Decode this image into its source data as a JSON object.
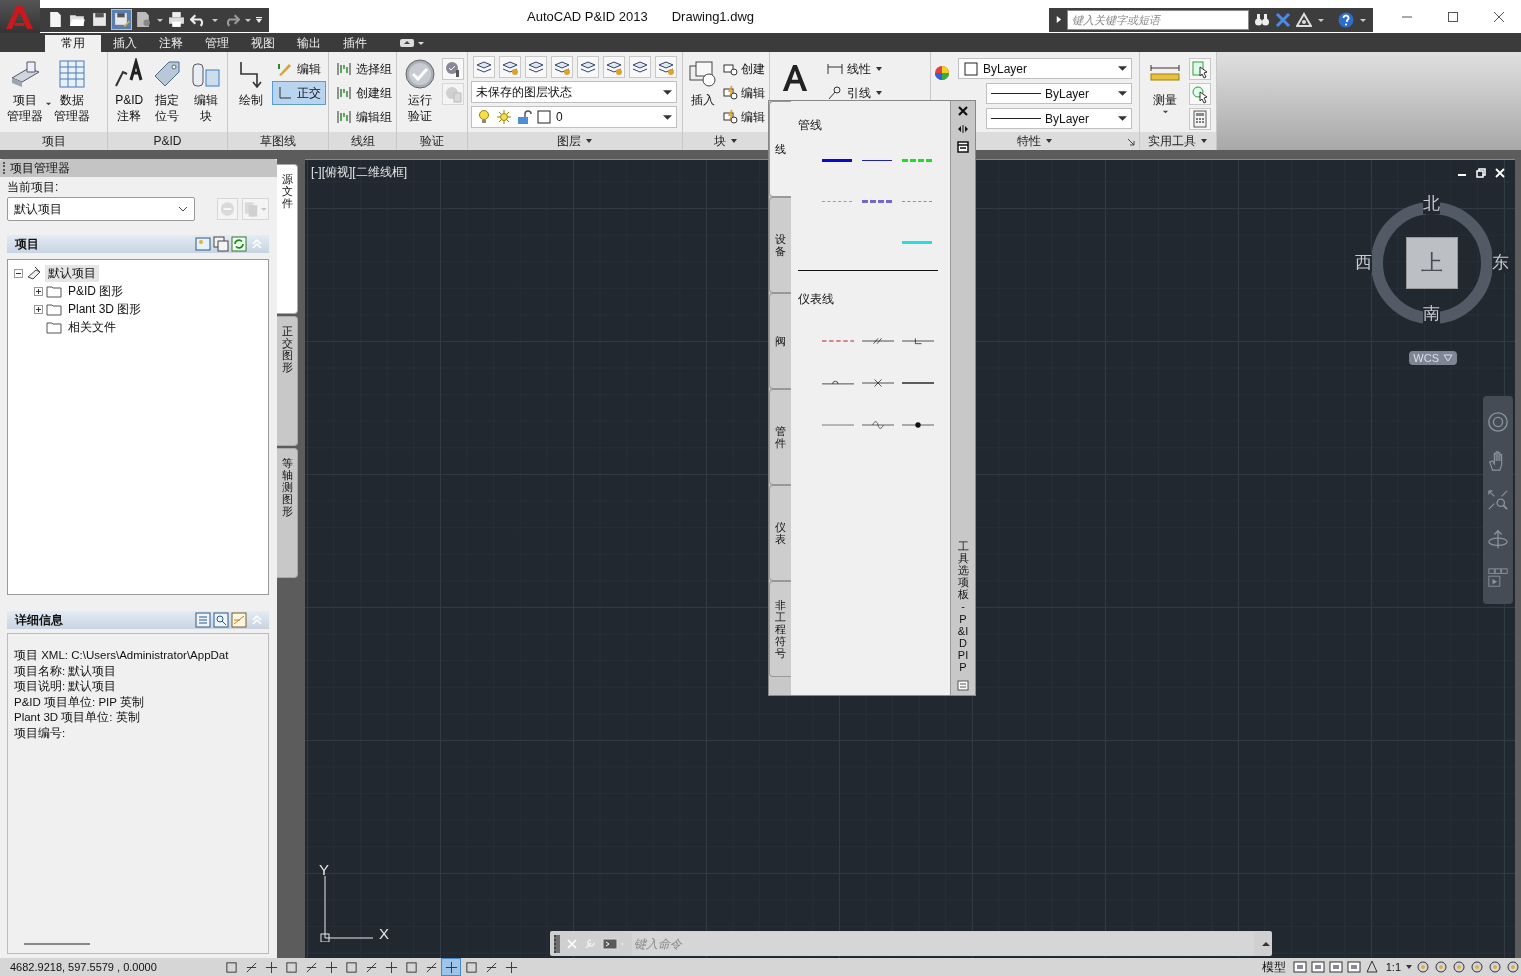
{
  "title_bar": {
    "app_title": "AutoCAD P&ID 2013",
    "document": "Drawing1.dwg",
    "search": {
      "placeholder": "键入关键字或短语"
    }
  },
  "ribbon_tabs": [
    {
      "label": "常用",
      "selected": true
    },
    {
      "label": "插入",
      "selected": false
    },
    {
      "label": "注释",
      "selected": false
    },
    {
      "label": "管理",
      "selected": false
    },
    {
      "label": "视图",
      "selected": false
    },
    {
      "label": "输出",
      "selected": false
    },
    {
      "label": "插件",
      "selected": false
    }
  ],
  "ribbon": {
    "project": {
      "title": "项目",
      "tools": [
        [
          "项目",
          "管理器"
        ],
        [
          "数据",
          "管理器"
        ]
      ]
    },
    "pid": {
      "title": "P&ID",
      "tools": [
        [
          "P&ID",
          "注释"
        ],
        [
          "指定",
          "位号"
        ],
        [
          "编辑",
          "块"
        ]
      ]
    },
    "sketch": {
      "title": "草图线",
      "draw": "绘制",
      "edit": "编辑",
      "ortho": {
        "label": "正交",
        "on": true
      }
    },
    "line_group": {
      "title": "线组",
      "tools": [
        "选择组",
        "创建组",
        "编辑组"
      ]
    },
    "validate": {
      "title": "验证",
      "run": [
        "运行",
        "验证"
      ]
    },
    "layers": {
      "title": "图层",
      "layer_state": "未保存的图层状态",
      "current_layer": "0"
    },
    "block": {
      "title": "块",
      "insert": "插入",
      "tools": [
        "创建",
        "编辑",
        "编辑"
      ]
    },
    "annotation": {
      "tools": [
        "线性",
        "引线"
      ]
    },
    "properties": {
      "title": "特性",
      "color_setting": "ByLayer",
      "lineweight": "ByLayer",
      "linetype": "ByLayer"
    },
    "utilities": {
      "title": "实用工具",
      "measure": "测量"
    }
  },
  "project_manager": {
    "title": "项目管理器",
    "current_label": "当前项目:",
    "current_project": "默认项目",
    "project_section": "项目",
    "tree": [
      {
        "label": "默认项目",
        "selected": true,
        "expandable": true,
        "expanded": true,
        "children": [
          {
            "label": "P&ID 图形",
            "selected": false,
            "expandable": true,
            "expanded": false
          },
          {
            "label": "Plant 3D 图形",
            "selected": false,
            "expandable": true,
            "expanded": false
          },
          {
            "label": "相关文件",
            "selected": false,
            "expandable": false
          }
        ]
      }
    ],
    "details_section": "详细信息",
    "details": [
      "项目 XML:  C:\\Users\\Administrator\\AppDat",
      "项目名称:  默认项目",
      "项目说明:  默认项目",
      "P&ID 项目单位:  PIP 英制",
      "Plant  3D 项目单位:  英制",
      "项目编号:"
    ],
    "side_tabs": [
      {
        "label": "源文件",
        "selected": true
      },
      {
        "label": "正交图形",
        "selected": false
      },
      {
        "label": "等轴测图形",
        "selected": false
      }
    ]
  },
  "viewport": {
    "label": "[-][俯视][二维线框]",
    "viewcube": {
      "north": "北",
      "east": "东",
      "south": "南",
      "west": "西",
      "face": "上"
    },
    "ucs_menu": "WCS",
    "ucs_icon": {
      "x": "X",
      "y": "Y"
    }
  },
  "command_line": {
    "placeholder": "键入命令"
  },
  "tool_palette": {
    "title": "工具选项板 - P&ID PIP",
    "tabs": [
      {
        "label": "线",
        "selected": true
      },
      {
        "label": "设备",
        "selected": false
      },
      {
        "label": "阀",
        "selected": false
      },
      {
        "label": "管件",
        "selected": false
      },
      {
        "label": "仪表",
        "selected": false
      },
      {
        "label": "非工程符号",
        "selected": false
      }
    ],
    "pipe_lines": {
      "heading": "管线",
      "samples": [
        {
          "kind": "solid-thick",
          "color": "#0a0ac8"
        },
        {
          "kind": "solid-thin",
          "color": "#2020b0"
        },
        {
          "kind": "dashed-thick",
          "color": "#22dd22"
        },
        {
          "kind": "dashed-thin",
          "color": "#44dd44"
        },
        {
          "kind": "dashed-thick",
          "color": "#7766cc"
        },
        {
          "kind": "dashed-thin",
          "color": "#8888cc"
        },
        {
          "kind": "solid-thick",
          "color": "#22e0e0"
        }
      ]
    },
    "instrument_lines": {
      "heading": "仪表线",
      "symbols": [
        {
          "kind": "dashed"
        },
        {
          "kind": "double-slash"
        },
        {
          "kind": "capillary"
        },
        {
          "kind": "arc"
        },
        {
          "kind": "cross"
        },
        {
          "kind": "thick"
        },
        {
          "kind": "thin"
        },
        {
          "kind": "wave"
        },
        {
          "kind": "dot"
        }
      ]
    }
  },
  "status_bar": {
    "coordinates": "4682.9218, 597.5579 , 0.0000",
    "toggles": [
      {
        "on": false
      },
      {
        "on": false
      },
      {
        "on": false
      },
      {
        "on": false
      },
      {
        "on": false
      },
      {
        "on": false
      },
      {
        "on": false
      },
      {
        "on": false
      },
      {
        "on": false
      },
      {
        "on": false
      },
      {
        "on": false
      },
      {
        "on": true
      },
      {
        "on": false
      },
      {
        "on": false
      },
      {
        "on": false
      }
    ],
    "model": "模型",
    "scale": "1:1"
  }
}
